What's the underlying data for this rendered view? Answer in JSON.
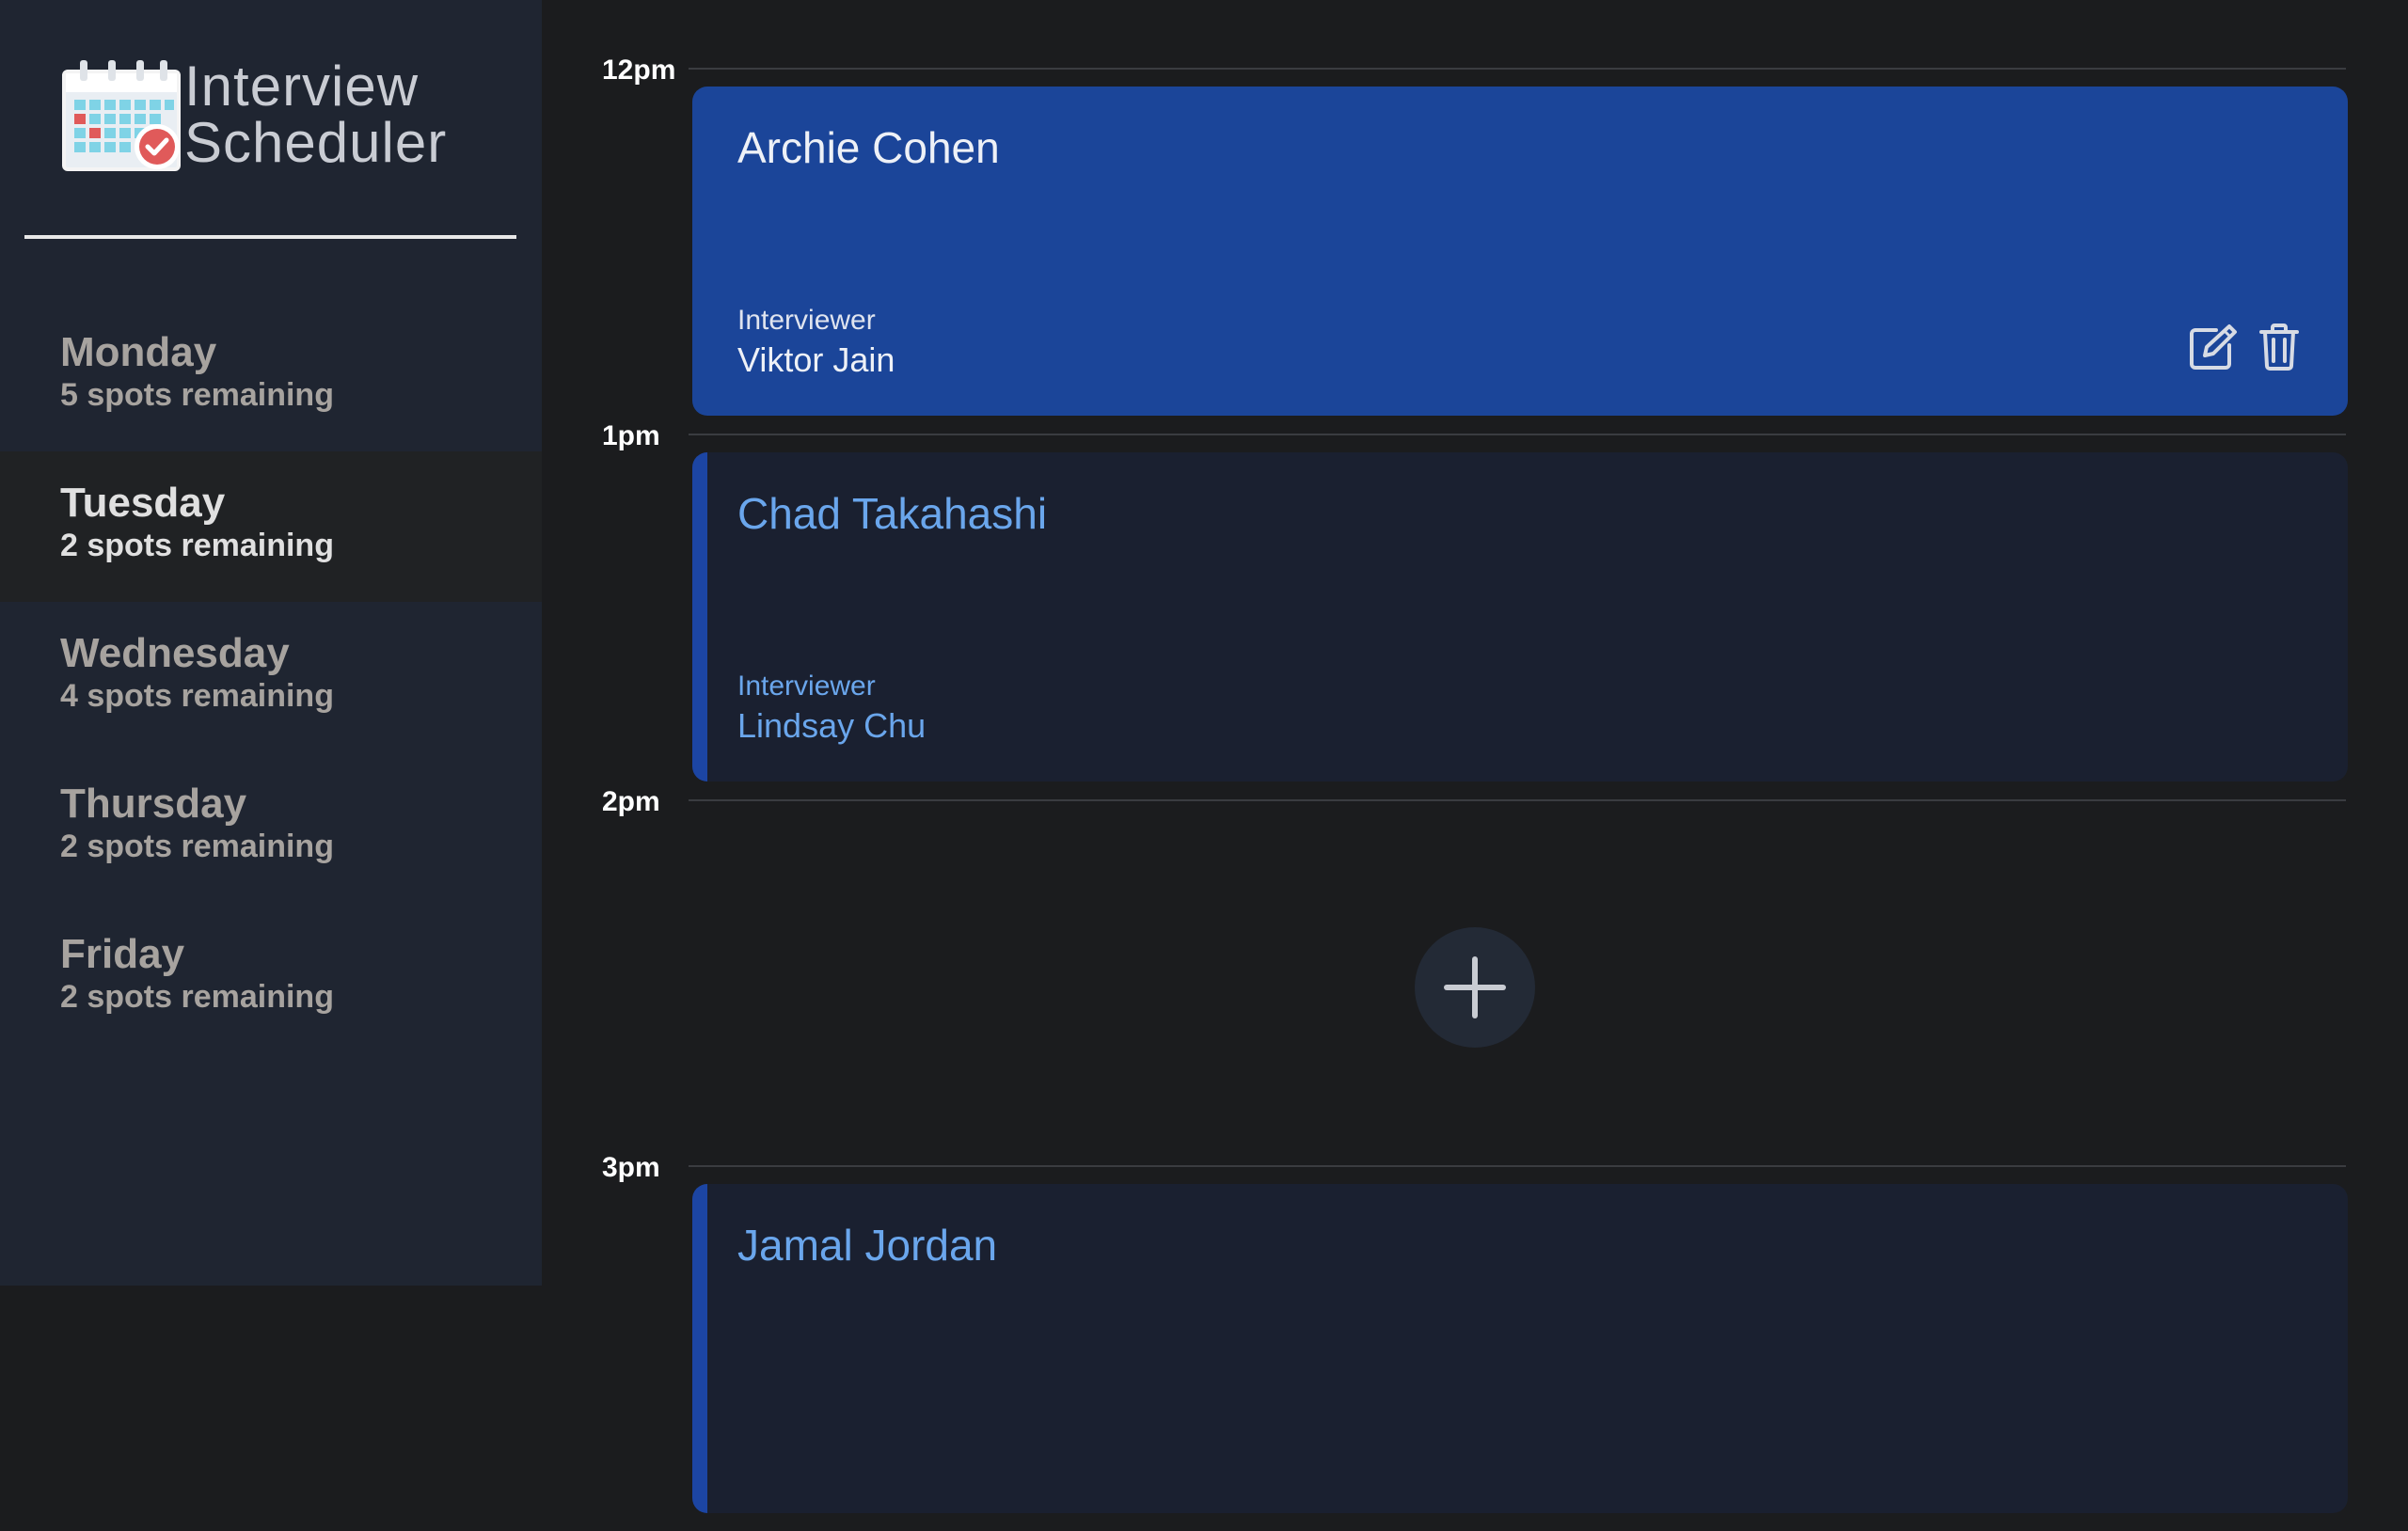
{
  "brand": {
    "line1": "Interview",
    "line2": "Scheduler"
  },
  "days": [
    {
      "name": "Monday",
      "spots": "5 spots remaining",
      "selected": false
    },
    {
      "name": "Tuesday",
      "spots": "2 spots remaining",
      "selected": true
    },
    {
      "name": "Wednesday",
      "spots": "4 spots remaining",
      "selected": false
    },
    {
      "name": "Thursday",
      "spots": "2 spots remaining",
      "selected": false
    },
    {
      "name": "Friday",
      "spots": "2 spots remaining",
      "selected": false
    }
  ],
  "schedule": {
    "slots": [
      {
        "time": "12pm",
        "student": "Archie Cohen",
        "interviewer_label": "Interviewer",
        "interviewer": "Viktor Jain"
      },
      {
        "time": "1pm",
        "student": "Chad Takahashi",
        "interviewer_label": "Interviewer",
        "interviewer": "Lindsay Chu"
      },
      {
        "time": "2pm"
      },
      {
        "time": "3pm",
        "student": "Jamal Jordan"
      }
    ]
  },
  "icons": {
    "logo": "calendar-check-icon",
    "edit": "edit-icon",
    "delete": "trash-icon",
    "add": "plus-icon"
  },
  "colors": {
    "sidebar_bg": "#1f2531",
    "main_bg": "#1b1c1e",
    "accent": "#1c45a3",
    "card_text": "#6aa6ec",
    "active_card_bg": "#1b4599"
  }
}
